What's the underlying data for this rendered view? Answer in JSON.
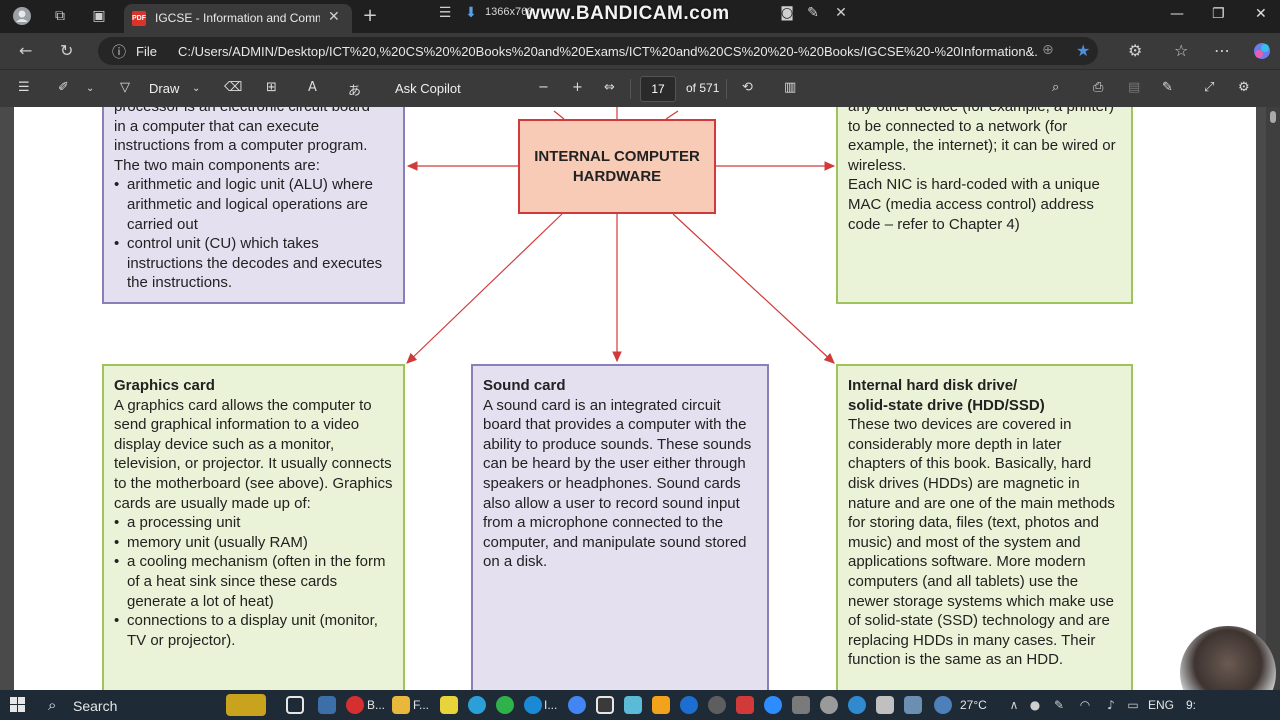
{
  "browser": {
    "tab_title": "IGCSE - Information and Commu",
    "tab_icon_label": "PDF",
    "file_label": "File",
    "url": "C:/Users/ADMIN/Desktop/ICT%20,%20CS%20%20Books%20and%20Exams/ICT%20and%20CS%20%20-%20Books/IGCSE%20-%20Information&..."
  },
  "recorder": {
    "resolution": "1366x768",
    "watermark": "www.BANDICAM.com"
  },
  "pdf_toolbar": {
    "draw_label": "Draw",
    "copilot_label": "Ask Copilot",
    "page_current": "17",
    "page_total": "of 571"
  },
  "document": {
    "center": {
      "line1": "INTERNAL COMPUTER",
      "line2": "HARDWARE"
    },
    "processor": {
      "lines": [
        "processor is an electronic circuit board",
        "in a computer that can execute",
        "instructions from a computer program.",
        "The two main components are:"
      ],
      "bullets": [
        "arithmetic and logic unit (ALU) where arithmetic and logical operations are carried out",
        "control unit (CU) which takes instructions the decodes and executes the instructions."
      ]
    },
    "nic": {
      "text1": "any other device (for example, a printer) to be connected to a network (for example, the internet); it can be wired or wireless.",
      "text2": "Each NIC is hard-coded with a unique MAC (media access control) address code – refer to Chapter 4)"
    },
    "graphics": {
      "title": "Graphics card",
      "text": "A graphics card allows the computer to send graphical information to a video display device such as a monitor, television, or projector. It usually connects to the motherboard (see above). Graphics cards are usually made up of:",
      "bullets": [
        "a processing unit",
        "memory unit (usually RAM)",
        "a cooling mechanism (often in the form of a heat sink since these cards generate a lot of heat)",
        "connections to a display unit (monitor, TV or projector)."
      ]
    },
    "sound": {
      "title": "Sound card",
      "text": "A sound card is an integrated circuit board that provides a computer with the ability to produce sounds.  These sounds can be heard by the user either through speakers or headphones. Sound cards also allow a user to record sound input from a microphone connected to the computer, and manipulate sound stored on a disk."
    },
    "hdd": {
      "title1": "Internal hard disk drive/",
      "title2": "solid-state drive (HDD/SSD)",
      "text": "These two devices are covered in considerably more depth in later chapters of this book. Basically, hard disk drives (HDDs) are magnetic in nature and are one of the main methods for storing data, files (text, photos and music) and most of the system and applications software. More modern computers (and all tablets) use the newer storage systems which make use of solid-state (SSD) technology and are replacing HDDs in many cases. Their function is the same as an HDD."
    }
  },
  "taskbar": {
    "search_label": "Search",
    "app1_label": "B...",
    "app2_label": "F...",
    "app3_label": "I...",
    "temperature": "27°C",
    "language": "ENG",
    "time": "9:"
  },
  "colors": {
    "purple_box": "#e4e0f0",
    "green_box": "#eaf2d7",
    "center_box": "#f8cbb6",
    "arrow": "#d13a3a"
  }
}
